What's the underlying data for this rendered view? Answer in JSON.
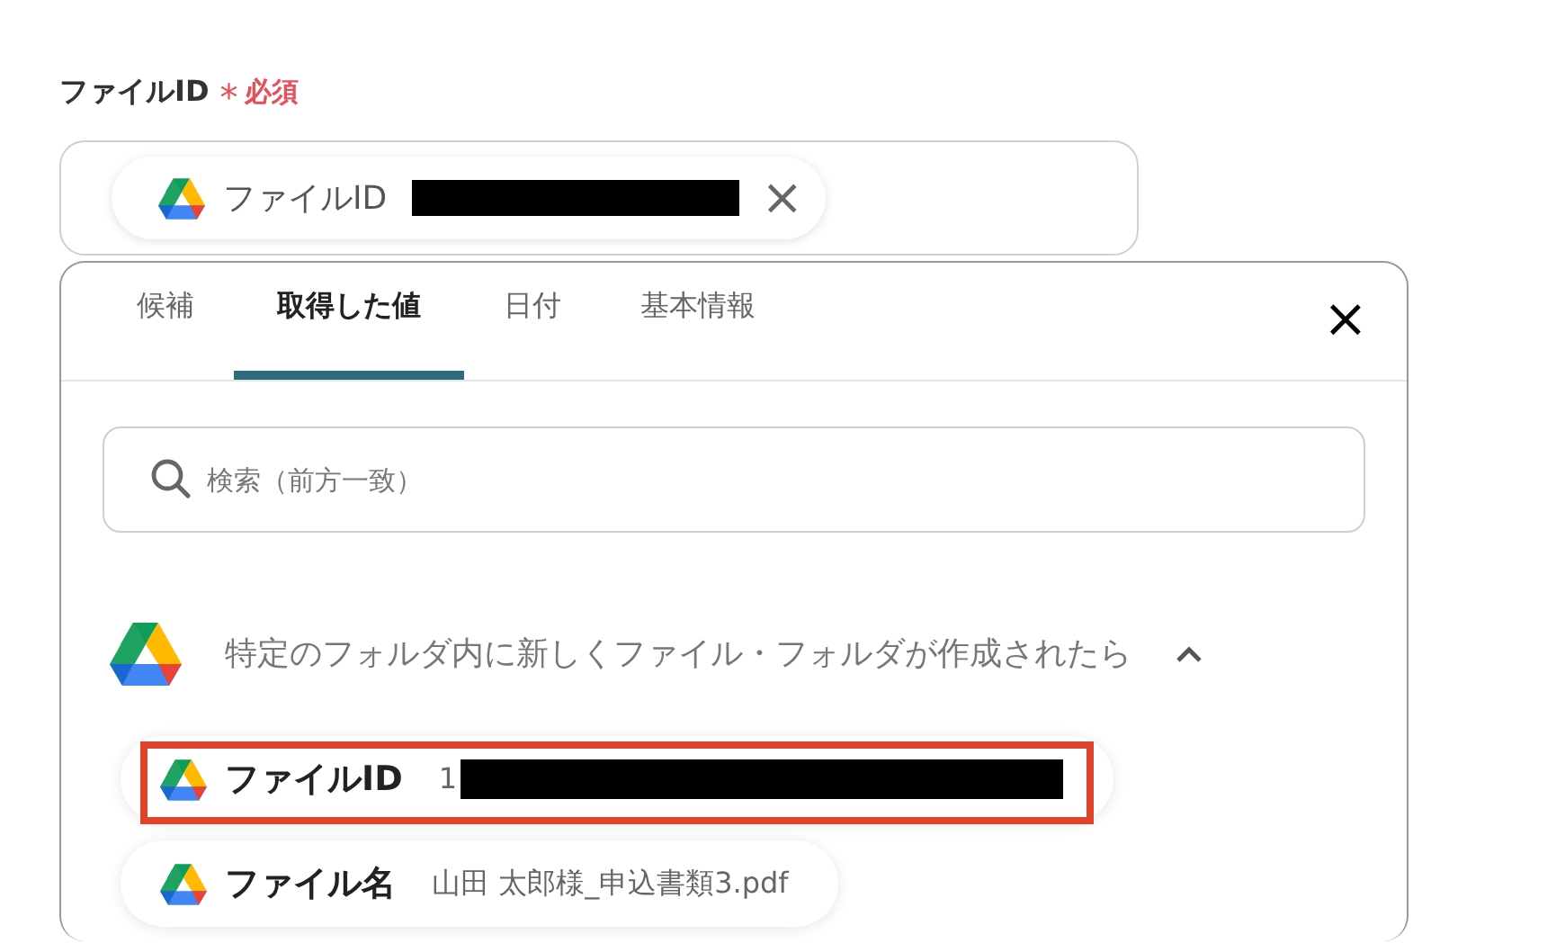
{
  "field": {
    "label": "ファイルID",
    "required_mark": "*",
    "required_text": "必須",
    "chip": {
      "label": "ファイルID",
      "redacted": true,
      "remove": "×"
    }
  },
  "panel": {
    "tabs": [
      {
        "label": "候補",
        "selected": false
      },
      {
        "label": "取得した値",
        "selected": true
      },
      {
        "label": "日付",
        "selected": false
      },
      {
        "label": "基本情報",
        "selected": false
      }
    ],
    "close": "×",
    "search": {
      "placeholder": "検索（前方一致）"
    },
    "group": {
      "title": "特定のフォルダ内に新しくファイル・フォルダが作成されたら",
      "expanded": true,
      "items": [
        {
          "name": "ファイルID",
          "value": "1",
          "redacted": true,
          "highlighted": true
        },
        {
          "name": "ファイル名",
          "value": "山田 太郎様_申込書類3.pdf",
          "redacted": false,
          "highlighted": false
        }
      ]
    }
  }
}
